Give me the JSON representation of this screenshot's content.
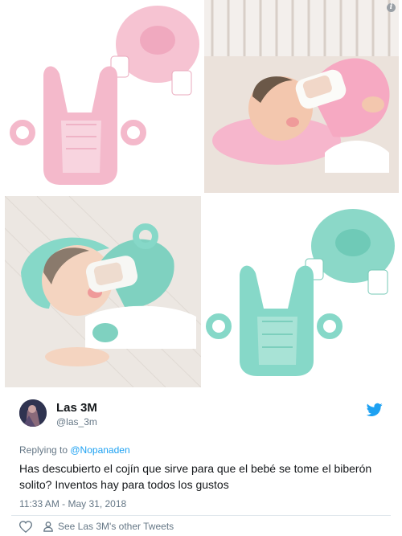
{
  "tweet": {
    "name": "Las 3M",
    "handle": "@las_3m",
    "replying_prefix": "Replying to ",
    "replying_to": "@Nopanaden",
    "text": "Has descubierto el cojín que sirve para que el bebé se tome el biberón solito? Inventos hay para todos los gustos",
    "timestamp": "11:33 AM - May 31, 2018",
    "see_other": "See Las 3M's other Tweets",
    "info_glyph": "i"
  },
  "icons": [
    "info-icon",
    "avatar",
    "twitter-bird-icon",
    "heart-icon",
    "person-icon"
  ],
  "colors": {
    "pink_pillow": "#f4b9cb",
    "mint_pillow": "#86d8c8",
    "link": "#1da1f2",
    "muted": "#657786"
  }
}
